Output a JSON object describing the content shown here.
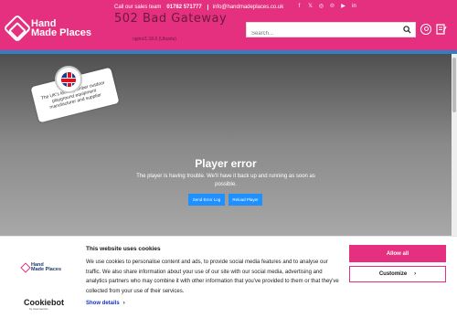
{
  "header": {
    "sales_label": "Call our sales team",
    "phone": "01782 571777",
    "email": "info@handmadeplaces.co.uk",
    "social": [
      "facebook-icon",
      "x-icon",
      "instagram-icon",
      "pinterest-icon",
      "youtube-icon",
      "linkedin-icon"
    ],
    "social_glyphs": [
      "f",
      "𝕏",
      "◎",
      "℗",
      "▶",
      "in"
    ],
    "logo_line1": "Hand",
    "logo_line2": "Made Places",
    "error_title": "502 Bad Gateway",
    "error_sub": "nginx/1.18.0 (Ubuntu)",
    "search_placeholder": "Search..."
  },
  "hero": {
    "badge_text": "The UK's leading timber outdoor playground equipment manufacturer and supplier"
  },
  "player": {
    "title": "Player error",
    "message": "The player is having trouble. We'll have it back up and running as soon as possible.",
    "send_label": "Send Error Log",
    "reload_label": "Reload Player"
  },
  "cookie": {
    "title": "This website uses cookies",
    "body": "We use cookies to personalise content and ads, to provide social media features and to analyse our traffic. We also share information about your use of our site with our social media, advertising and analytics partners who may combine it with other information that you've provided to them or that they've collected from your use of their services.",
    "details_label": "Show details",
    "allow_label": "Allow all",
    "customize_label": "Customize",
    "logo_line1": "Hand",
    "logo_line2": "Made Places",
    "cookiebot_label": "Cookiebot",
    "cookiebot_sub": "by Usercentrics"
  },
  "colors": {
    "brand_pink": "#e4307f",
    "accent_blue": "#2f7fc1",
    "button_blue": "#1e90ff"
  }
}
